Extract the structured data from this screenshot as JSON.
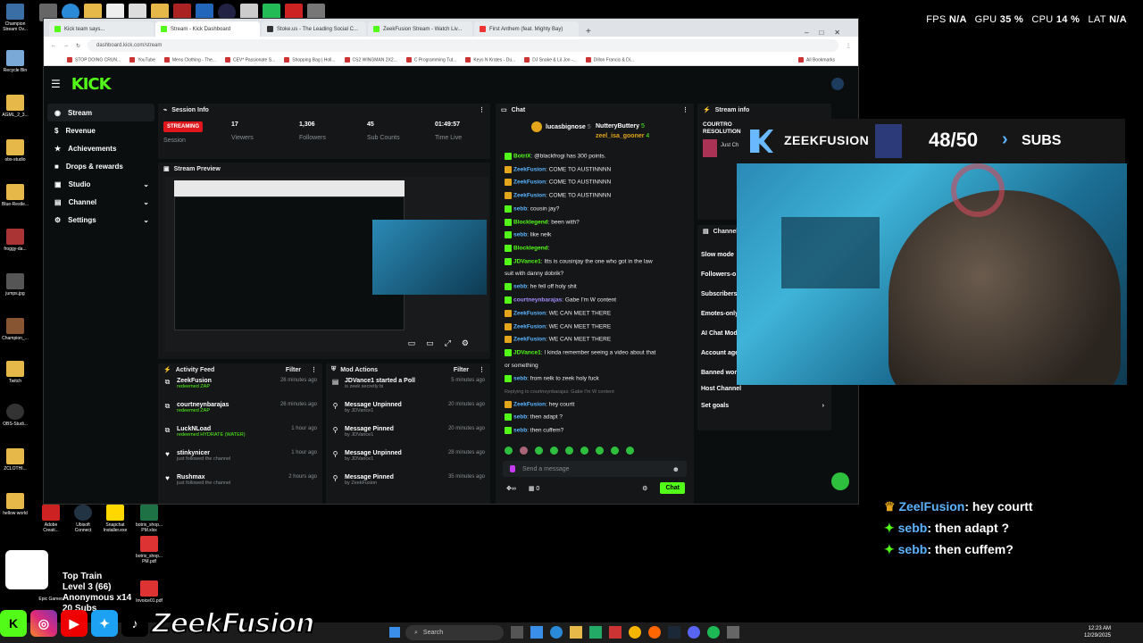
{
  "stats": {
    "fps_label": "FPS",
    "fps": "N/A",
    "gpu_label": "GPU",
    "gpu": "35 %",
    "cpu_label": "CPU",
    "cpu": "14 %",
    "lat_label": "LAT",
    "lat": "N/A"
  },
  "desktop": {
    "left_icons": [
      "Champion Stream Ov...",
      "Recycle Bin",
      "AGML_2_3...",
      "obs-studio",
      "Blue-Restle...",
      "froggy-da...",
      "jumps.jpg",
      "Champion_...",
      "Twitch",
      "OBS-Studi...",
      "ZCLOTHI...",
      "hellow world"
    ],
    "bottom_icons": [
      "Adobe Creati...",
      "Ubisoft Connect",
      "Snapchat Installer.exe",
      "botrix_shop... PM.xlsx",
      "Invoice01.pdf",
      "Epic Games",
      "botrix_shop... PM.pdf"
    ]
  },
  "browser": {
    "tabs": [
      "Kick team says...",
      "Stream - Kick Dashboard",
      "Stoke.us - The Leading Social C...",
      "ZeekFusion Stream - Watch Liv...",
      "First Anthem (feat. Mighty Bay)"
    ],
    "url": "dashboard.kick.com/stream",
    "bookmarks": [
      "STOP DOING CRUN...",
      "YouTube",
      "Mens Clothing - The...",
      "CEV* Passionate S...",
      "Shopping Bag | Holl...",
      "CS2 WINGMAN 2X2...",
      "C Programming Tut...",
      "Keys N Krates - Du...",
      "DJ Snake & Lil Jon -...",
      "Dillon Francis & Di..."
    ],
    "all_bookmarks": "All Bookmarks"
  },
  "kick": {
    "logo": "KICK",
    "nav": [
      {
        "label": "Stream"
      },
      {
        "label": "Revenue"
      },
      {
        "label": "Achievements"
      },
      {
        "label": "Drops & rewards"
      },
      {
        "label": "Studio"
      },
      {
        "label": "Channel"
      },
      {
        "label": "Settings"
      }
    ],
    "session": {
      "title": "Session Info",
      "status": "STREAMING",
      "status_label": "Session",
      "viewers": "17",
      "viewers_label": "Viewers",
      "followers": "1,306",
      "followers_label": "Followers",
      "subs": "45",
      "subs_label": "Sub Counts",
      "time": "01:49:57",
      "time_label": "Time Live"
    },
    "preview_title": "Stream Preview",
    "activity": {
      "title": "Activity Feed",
      "filter": "Filter",
      "rows": [
        {
          "name": "ZeekFusion",
          "sub": "redeemed ZAP",
          "time": "26 minutes ago"
        },
        {
          "name": "courtneynbarajas",
          "sub": "redeemed ZAP",
          "time": "26 minutes ago"
        },
        {
          "name": "LuckNLoad",
          "sub": "redeemed HYDRATE (WATER)",
          "time": "1 hour ago"
        },
        {
          "name": "stinkynicer",
          "sub": "just followed the channel",
          "time": "1 hour ago"
        },
        {
          "name": "Rushmax",
          "sub": "just followed the channel",
          "time": "2 hours ago"
        }
      ]
    },
    "mod": {
      "title": "Mod Actions",
      "filter": "Filter",
      "rows": [
        {
          "name": "JDVance1 started a Poll",
          "sub": "is zeek secretly bi",
          "time": "5 minutes ago"
        },
        {
          "name": "Message Unpinned",
          "sub": "by JDVance1",
          "time": "20 minutes ago"
        },
        {
          "name": "Message Pinned",
          "sub": "by JDVance1",
          "time": "20 minutes ago"
        },
        {
          "name": "Message Unpinned",
          "sub": "by JDVance1",
          "time": "28 minutes ago"
        },
        {
          "name": "Message Pinned",
          "sub": "by ZeekFusion",
          "time": "35 minutes ago"
        }
      ]
    },
    "chat": {
      "title": "Chat",
      "top1": "lucasbignose",
      "top1_n": "5",
      "top2": "NutteryButtery",
      "top2_n": "5",
      "top3": "zeel_isa_gooner",
      "top3_n": "4",
      "messages": [
        {
          "u": "BotriX",
          "t": "@blackfrogi has 300 points."
        },
        {
          "u": "ZeekFusion",
          "t": "COME TO AUSTINNNN"
        },
        {
          "u": "ZeekFusion",
          "t": "COME TO AUSTINNNN"
        },
        {
          "u": "ZeekFusion",
          "t": "COME TO AUSTINNNN"
        },
        {
          "u": "sebb",
          "t": "cousin jay?"
        },
        {
          "u": "Blocklegend",
          "t": "been with?"
        },
        {
          "u": "sebb",
          "t": "like nelk"
        },
        {
          "u": "Blocklegend",
          "t": ""
        },
        {
          "u": "JDVance1",
          "t": "Itts is cousinjay the one who got in the law"
        },
        {
          "u": "",
          "t": "suit with danny dobrik?"
        },
        {
          "u": "sebb",
          "t": "he fell off holy shit"
        },
        {
          "u": "courtneynbarajas",
          "t": "Gabe I'm W content"
        },
        {
          "u": "ZeekFusion",
          "t": "WE CAN MEET THERE"
        },
        {
          "u": "ZeekFusion",
          "t": "WE CAN MEET THERE"
        },
        {
          "u": "ZeekFusion",
          "t": "WE CAN MEET THERE"
        },
        {
          "u": "JDVance1",
          "t": "I kinda remember seeing a video about that"
        },
        {
          "u": "",
          "t": "or something"
        },
        {
          "u": "sebb",
          "t": "from nelk to zeek holy fuck"
        },
        {
          "u": "",
          "t": "Replying to courtneynbarajas: Gabe I'm W content"
        },
        {
          "u": "ZeekFusion",
          "t": "hey courtt"
        },
        {
          "u": "sebb",
          "t": "then adapt ?"
        },
        {
          "u": "sebb",
          "t": "then cuffem?"
        }
      ],
      "placeholder": "Send a message",
      "count": "0",
      "send": "Chat"
    },
    "streaminfo": {
      "title": "Stream info",
      "line1": "COURTRO",
      "line2": "RESOLUTION",
      "line3": "Just Ch"
    },
    "channel": {
      "title": "Channel",
      "rows": [
        "Slow mode",
        "Followers-o",
        "Subscribers",
        "Emotes-only",
        "AI Chat Mod",
        "Account age",
        "Banned wor",
        "Host Channel",
        "Set goals"
      ]
    }
  },
  "overlay": {
    "brand": "ZEEKFUSION",
    "goal": "48/50",
    "subs": "SUBS",
    "chat": [
      {
        "u": "ZeelFusion",
        "t": ": hey courtt"
      },
      {
        "u": "sebb",
        "t": ": then adapt ?"
      },
      {
        "u": "sebb",
        "t": ": then cuffem?"
      }
    ],
    "train1": "Top Train",
    "train2": "Level 3  (66)",
    "train3": "Anonymous x14",
    "train4": "20 Subs",
    "bottom_brand": "ZeekFusion"
  },
  "taskbar": {
    "search": "Search",
    "time": "12:23 AM",
    "date": "12/29/2025"
  }
}
